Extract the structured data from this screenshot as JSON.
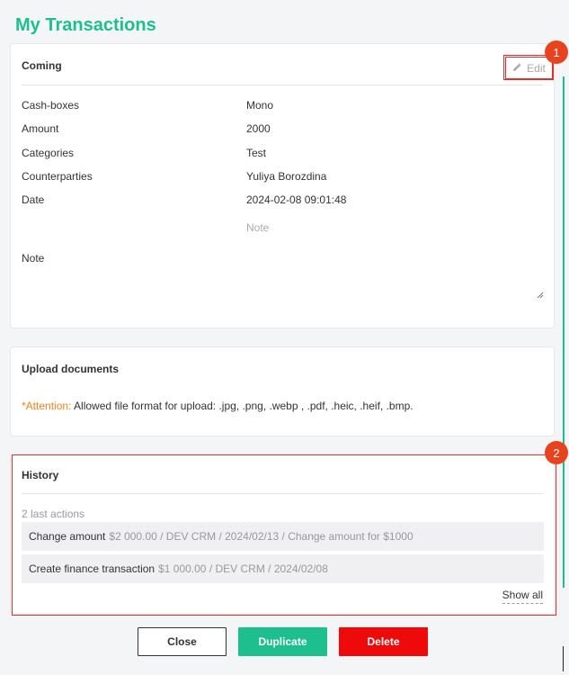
{
  "page": {
    "title": "My Transactions"
  },
  "coming": {
    "title": "Coming",
    "edit_label": "Edit",
    "fields": [
      {
        "label": "Cash-boxes",
        "value": "Mono"
      },
      {
        "label": "Amount",
        "value": "2000"
      },
      {
        "label": "Categories",
        "value": "Test"
      },
      {
        "label": "Counterparties",
        "value": "Yuliya Borozdina"
      },
      {
        "label": "Date",
        "value": "2024-02-08 09:01:48"
      }
    ],
    "note_placeholder": "Note",
    "note_label": "Note"
  },
  "upload": {
    "title": "Upload documents",
    "attention_prefix": "*Attention:",
    "attention_text": " Allowed file format for upload: .jpg, .png, .webp , .pdf, .heic, .heif, .bmp."
  },
  "history": {
    "title": "History",
    "subtitle": "2 last actions",
    "items": [
      {
        "action": "Change amount",
        "meta": "$2 000.00 / DEV CRM / 2024/02/13 / Change amount for $1000"
      },
      {
        "action": "Create finance transaction",
        "meta": "$1 000.00 / DEV CRM / 2024/02/08"
      }
    ],
    "show_all": "Show all"
  },
  "buttons": {
    "close": "Close",
    "duplicate": "Duplicate",
    "delete": "Delete"
  },
  "markers": [
    "1",
    "2"
  ],
  "colors": {
    "accent": "#1dbf8e",
    "danger": "#ee0a0a",
    "warning": "#f5821f",
    "highlight": "#e0302f"
  },
  "icons": {
    "edit": "pencil-icon"
  }
}
